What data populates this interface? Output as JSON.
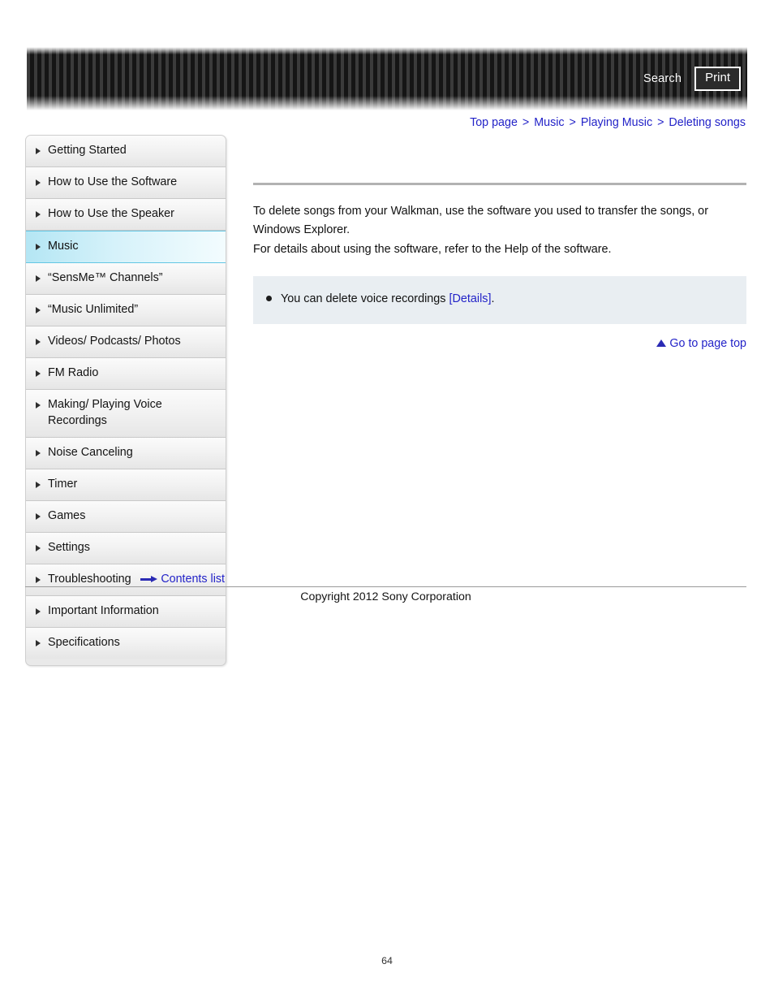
{
  "header": {
    "search_label": "Search",
    "print_label": "Print"
  },
  "breadcrumb": {
    "separator": ">",
    "items": [
      {
        "label": "Top page"
      },
      {
        "label": "Music"
      },
      {
        "label": "Playing Music"
      },
      {
        "label": "Deleting songs"
      }
    ]
  },
  "sidebar": {
    "items": [
      {
        "label": "Getting Started",
        "active": false
      },
      {
        "label": "How to Use the Software",
        "active": false
      },
      {
        "label": "How to Use the Speaker",
        "active": false
      },
      {
        "label": "Music",
        "active": true
      },
      {
        "label": "“SensMe™ Channels”",
        "active": false
      },
      {
        "label": "“Music Unlimited”",
        "active": false
      },
      {
        "label": "Videos/ Podcasts/ Photos",
        "active": false
      },
      {
        "label": "FM Radio",
        "active": false
      },
      {
        "label": "Making/ Playing Voice Recordings",
        "active": false
      },
      {
        "label": "Noise Canceling",
        "active": false
      },
      {
        "label": "Timer",
        "active": false
      },
      {
        "label": "Games",
        "active": false
      },
      {
        "label": "Settings",
        "active": false
      },
      {
        "label": "Troubleshooting",
        "active": false
      },
      {
        "label": "Important Information",
        "active": false
      },
      {
        "label": "Specifications",
        "active": false
      }
    ],
    "contents_list_label": "Contents list"
  },
  "main": {
    "paragraph_1": "To delete songs from your Walkman, use the software you used to transfer the songs, or Windows Explorer.",
    "paragraph_2": "For details about using the software, refer to the Help of the software.",
    "note": {
      "text_before": "You can delete voice recordings ",
      "link_label": "[Details]",
      "text_after": "."
    },
    "page_top_label": "Go to page top"
  },
  "footer": {
    "copyright": "Copyright 2012 Sony Corporation",
    "page_number": "64"
  },
  "colors": {
    "link": "#2323c8",
    "accent_highlight": "#b4e6f4",
    "note_background": "#e9eef2",
    "rule": "#b2b2b2"
  }
}
